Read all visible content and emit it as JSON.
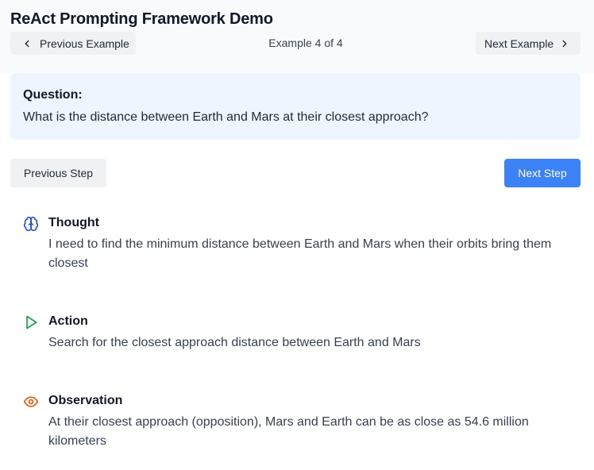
{
  "app": {
    "title": "ReAct Prompting Framework Demo"
  },
  "navigation": {
    "prev_label": "Previous Example",
    "next_label": "Next Example",
    "counter": "Example 4 of 4"
  },
  "question": {
    "label": "Question:",
    "text": "What is the distance between Earth and Mars at their closest approach?"
  },
  "controls": {
    "prev_step_label": "Previous Step",
    "next_step_label": "Next Step"
  },
  "steps": [
    {
      "type": "thought",
      "title": "Thought",
      "text": "I need to find the minimum distance between Earth and Mars when their orbits bring them closest",
      "icon": "brain-icon",
      "color": "#1d4ed8"
    },
    {
      "type": "action",
      "title": "Action",
      "text": "Search for the closest approach distance between Earth and Mars",
      "icon": "play-icon",
      "color": "#16a34a"
    },
    {
      "type": "observation",
      "title": "Observation",
      "text": "At their closest approach (opposition), Mars and Earth can be as close as 54.6 million kilometers",
      "icon": "eye-icon",
      "color": "#ea580c"
    }
  ],
  "colors": {
    "primary": "#3b82f6",
    "question_bg": "#eef5ff",
    "header_bg": "#f9fafb"
  }
}
